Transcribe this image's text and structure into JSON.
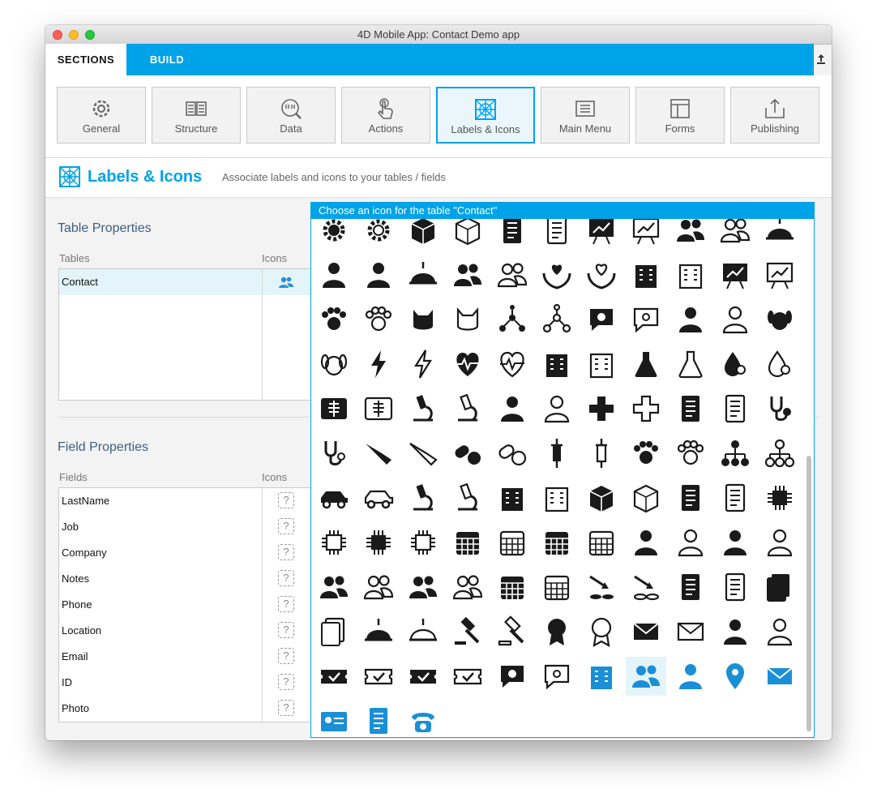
{
  "window": {
    "title": "4D Mobile App: Contact Demo app"
  },
  "tabs": {
    "sections": "SECTIONS",
    "build": "BUILD"
  },
  "upload_icon": "upload-icon",
  "sections": [
    {
      "label": "General",
      "icon": "gear-icon"
    },
    {
      "label": "Structure",
      "icon": "structure-icon"
    },
    {
      "label": "Data",
      "icon": "data-icon"
    },
    {
      "label": "Actions",
      "icon": "touch-icon"
    },
    {
      "label": "Labels & Icons",
      "icon": "labels-icons-icon",
      "active": true
    },
    {
      "label": "Main Menu",
      "icon": "menu-icon"
    },
    {
      "label": "Forms",
      "icon": "forms-icon"
    },
    {
      "label": "Publishing",
      "icon": "publish-icon"
    }
  ],
  "header": {
    "title": "Labels & Icons",
    "subtitle": "Associate labels and icons to your tables / fields"
  },
  "table_properties": {
    "title": "Table Properties",
    "col_tables": "Tables",
    "col_icons": "Icons",
    "rows": [
      {
        "name": "Contact",
        "icon": "users-icon"
      }
    ]
  },
  "field_properties": {
    "title": "Field Properties",
    "col_fields": "Fields",
    "col_icons": "Icons",
    "rows": [
      {
        "name": "LastName",
        "icon": "?"
      },
      {
        "name": "Job",
        "icon": "?"
      },
      {
        "name": "Company",
        "icon": "?"
      },
      {
        "name": "Notes",
        "icon": "?"
      },
      {
        "name": "Phone",
        "icon": "?"
      },
      {
        "name": "Location",
        "icon": "?"
      },
      {
        "name": "Email",
        "icon": "?"
      },
      {
        "name": "ID",
        "icon": "?"
      },
      {
        "name": "Photo",
        "icon": "?"
      }
    ]
  },
  "icon_picker": {
    "title": "Choose an icon for the table \"Contact\"",
    "selected": "users-group",
    "accent": "#00a2e8",
    "icons": [
      "gear-head",
      "gear-head-outline",
      "box",
      "box-outline",
      "list-doc",
      "list-doc-outline",
      "presenter",
      "presenter-outline",
      "team",
      "team-outline",
      "dome",
      "worker",
      "worker-basket",
      "dome-lamp",
      "group",
      "group-outline",
      "hands-heart",
      "hands-heart-outline",
      "building-columns",
      "building-columns-outline",
      "chart-board",
      "chart-board-outline",
      "paw",
      "paw-outline",
      "cat",
      "cat-outline",
      "molecule",
      "molecule-outline",
      "chat-plus",
      "chat-plus-outline",
      "nurse",
      "nurse-outline",
      "dog",
      "dog-outline",
      "bolt",
      "bolt-outline",
      "heartbeat",
      "heartbeat-outline",
      "hospital",
      "hospital-outline",
      "flask",
      "flask-outline",
      "drop-search",
      "drop-search-outline",
      "xray",
      "xray-outline",
      "microscope",
      "microscope-outline",
      "patient",
      "patient-outline",
      "cross",
      "cross-outline",
      "medical-doc",
      "medical-doc-outline",
      "stethoscope",
      "stethoscope-outline",
      "scalpel",
      "scalpel-outline",
      "pills",
      "pills-outline",
      "syringe",
      "syringe-outline",
      "paw-plus",
      "paw-plus-outline",
      "hierarchy",
      "hierarchy-outline",
      "car",
      "car-outline",
      "mri",
      "mri-outline",
      "factory",
      "factory-outline",
      "package",
      "package-outline",
      "notebook",
      "notebook-outline",
      "circuit",
      "circuit-outline",
      "cpu",
      "cpu-outline",
      "calendar",
      "calendar-outline",
      "table-grid",
      "table-grid-outline",
      "user-check",
      "user-check-outline",
      "user-coins",
      "user-coins-outline",
      "users-pair",
      "users-pair-outline",
      "users-group-dark",
      "users-group-dark-outline",
      "calculator",
      "calculator-outline",
      "coins-arrow",
      "coins-arrow-outline",
      "notebook-2",
      "notebook-2-outline",
      "papers",
      "papers-outline",
      "alarm",
      "alarm-outline",
      "gavel",
      "gavel-outline",
      "award",
      "award-outline",
      "envelope",
      "envelope-outline",
      "businessman",
      "businessman-outline",
      "ticket-check",
      "ticket-check-outline",
      "ticket-check-2",
      "ticket-check-2-outline",
      "chat-gear",
      "chat-gear-outline",
      "company-building",
      "users-group",
      "person-tie",
      "map-pin",
      "fast-mail",
      "id-card",
      "notes-pen",
      "phone"
    ]
  }
}
